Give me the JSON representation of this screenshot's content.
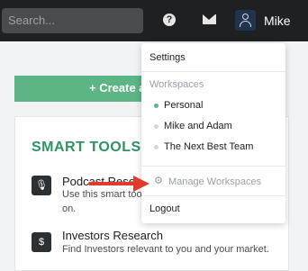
{
  "header": {
    "search_placeholder": "Search...",
    "help_icon": "help-icon",
    "mail_icon": "mail-icon",
    "username": "Mike"
  },
  "main": {
    "create_button_label": "+ Create a",
    "smart_tools_title": "SMART TOOLS",
    "tools": [
      {
        "icon": "microphone-icon",
        "title": "Podcast Research",
        "desc_line1": "Use this smart tool",
        "desc_line2": "on."
      },
      {
        "icon": "dollar-icon",
        "title": "Investors Research",
        "desc_line1": "Find Investors relevant to you and your market.",
        "desc_line2": ""
      }
    ]
  },
  "dropdown": {
    "settings": "Settings",
    "workspaces_header": "Workspaces",
    "workspaces": [
      {
        "label": "Personal",
        "active": true
      },
      {
        "label": "Mike and Adam",
        "active": false
      },
      {
        "label": "The Next Best Team",
        "active": false
      }
    ],
    "manage_workspaces": "Manage Workspaces",
    "logout": "Logout"
  },
  "colors": {
    "topbar": "#1f2021",
    "accent_green": "#5cb585",
    "title_green": "#2f9461",
    "annotation_arrow": "#e03c2e"
  }
}
